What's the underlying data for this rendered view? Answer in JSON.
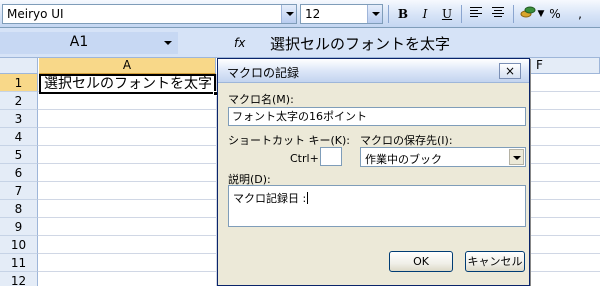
{
  "toolbar": {
    "font_name": "Meiryo UI",
    "font_size": "12",
    "bold": "B",
    "italic": "I",
    "underline": "U",
    "percent": "%",
    "comma": ","
  },
  "formula_bar": {
    "name_box": "A1",
    "fx": "fx",
    "content": "選択セルのフォントを太字"
  },
  "grid": {
    "columns": [
      "A",
      "F"
    ],
    "rows": [
      "1",
      "2",
      "3",
      "4",
      "5",
      "6",
      "7",
      "8",
      "9",
      "10",
      "11",
      "12"
    ],
    "cell_a1": "選択セルのフォントを太字"
  },
  "dialog": {
    "title": "マクロの記録",
    "close": "×",
    "macro_name_label": "マクロ名(M):",
    "macro_name_value": "フォント太字の16ポイント",
    "shortcut_label": "ショートカット キー(K):",
    "ctrl_prefix": "Ctrl+",
    "shortcut_value": "",
    "store_label": "マクロの保存先(I):",
    "store_value": "作業中のブック",
    "description_label": "説明(D):",
    "description_value": "マクロ記録日 :",
    "ok": "OK",
    "cancel": "キャンセル"
  }
}
